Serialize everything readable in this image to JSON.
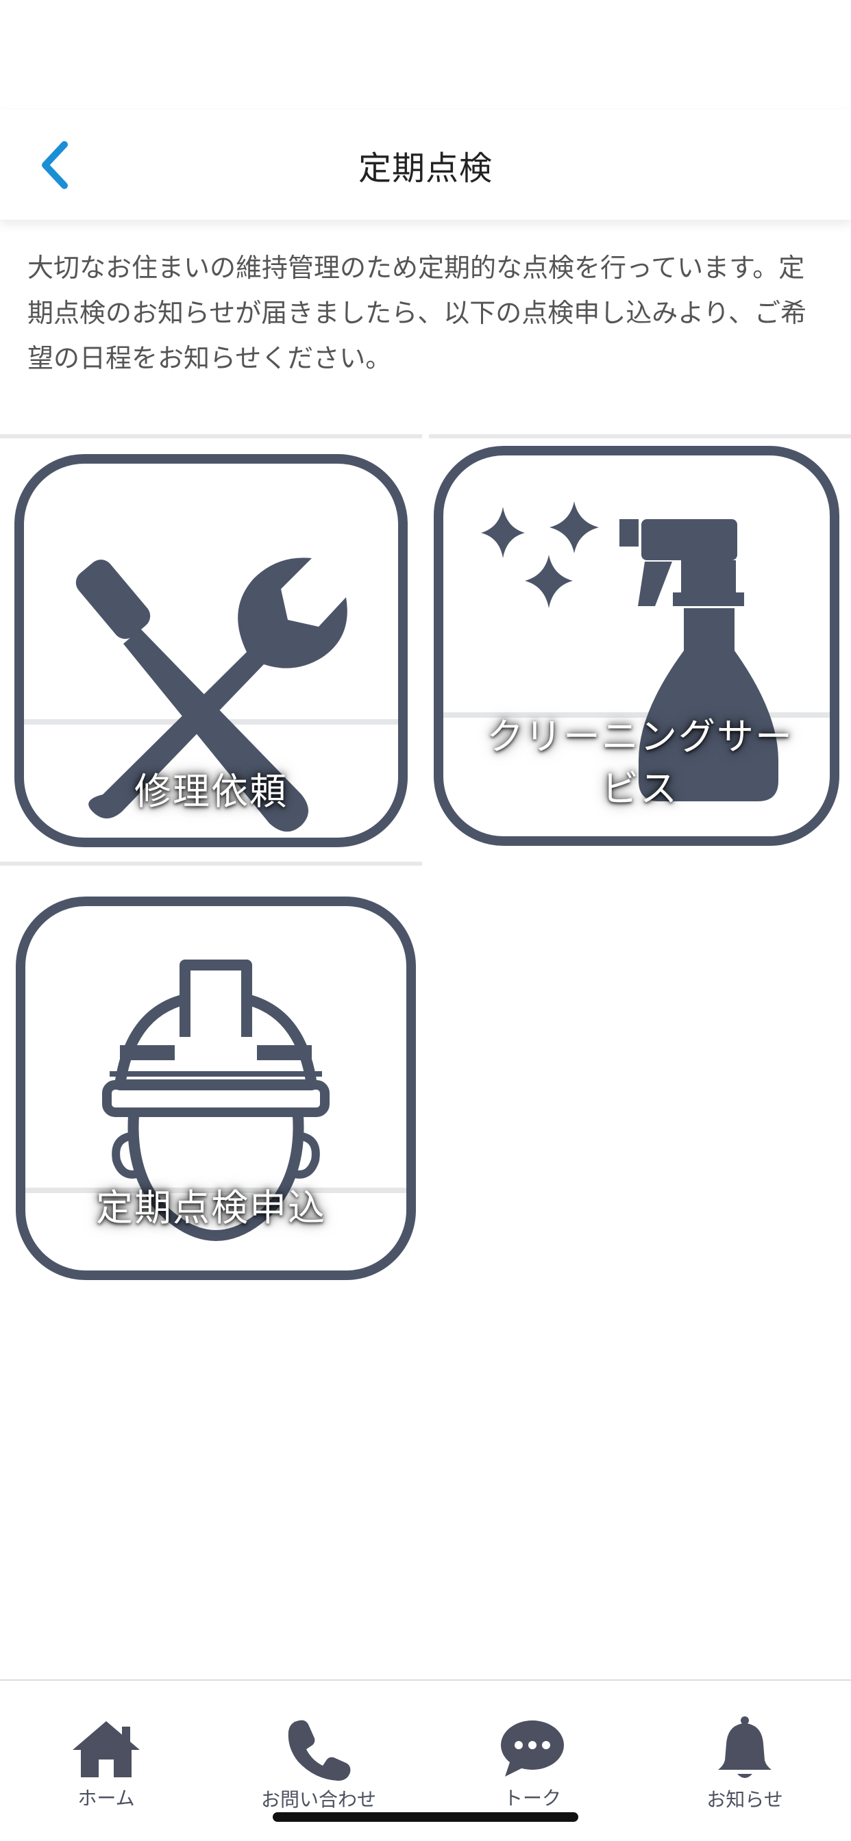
{
  "header": {
    "title": "定期点検",
    "back_icon": "chevron-left-icon"
  },
  "description": "大切なお住まいの維持管理のため定期的な点検を行っています。定期点検のお知らせが届きましたら、以下の点検申し込みより、ご希望の日程をお知らせください。",
  "tiles": [
    {
      "label": "修理依頼",
      "icon": "tools-icon"
    },
    {
      "label": "クリーニングサービス",
      "label_lines": [
        "クリーニングサー",
        "ビス"
      ],
      "icon": "spray-bottle-icon"
    },
    {
      "label": "定期点検申込",
      "icon": "hard-hat-worker-icon"
    }
  ],
  "tabbar": {
    "items": [
      {
        "label": "ホーム",
        "icon": "home-icon"
      },
      {
        "label": "お問い合わせ",
        "icon": "phone-icon"
      },
      {
        "label": "トーク",
        "icon": "chat-bubble-icon"
      },
      {
        "label": "お知らせ",
        "icon": "bell-icon"
      }
    ]
  },
  "colors": {
    "accent": "#1b8fd6",
    "icon": "#4c5568",
    "tab_icon": "#4c5060"
  }
}
